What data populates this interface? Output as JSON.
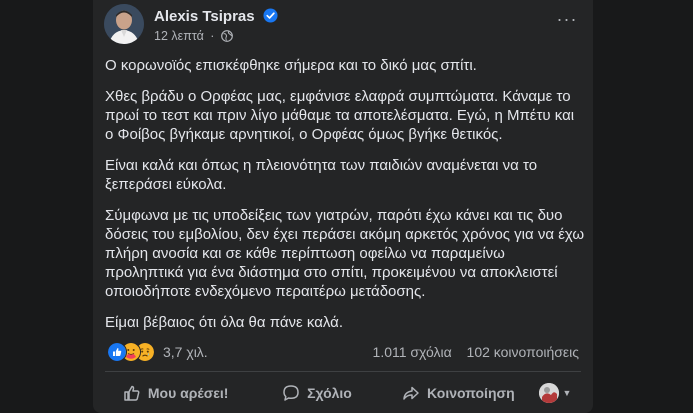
{
  "post": {
    "author": "Alexis Tsipras",
    "time": "12 λεπτά",
    "separator": "·",
    "more_label": "···",
    "paragraphs": [
      "Ο κορωνοϊός επισκέφθηκε σήμερα και το δικό μας σπίτι.",
      "Χθες βράδυ ο Ορφέας μας, εμφάνισε ελαφρά συμπτώματα. Κάναμε το πρωί το τεστ και πριν λίγο μάθαμε τα αποτελέσματα. Εγώ, η Μπέτυ και ο Φοίβος βγήκαμε αρνητικοί, ο Ορφέας όμως βγήκε θετικός.",
      "Είναι καλά και όπως η πλειονότητα των παιδιών αναμένεται να το ξεπεράσει εύκολα.",
      "Σύμφωνα με τις υποδείξεις των γιατρών, παρότι έχω κάνει και τις δυο δόσεις του εμβολίου, δεν έχει περάσει ακόμη αρκετός χρόνος για να έχω πλήρη ανοσία και σε κάθε περίπτωση οφείλω να παραμείνω προληπτικά για ένα διάστημα στο σπίτι, προκειμένου να αποκλειστεί οποιοδήποτε ενδεχόμενο περαιτέρω μετάδοσης.",
      "Είμαι βέβαιος ότι όλα θα πάνε καλά."
    ]
  },
  "stats": {
    "reactions": "3,7 χιλ.",
    "comments": "1.011 σχόλια",
    "shares": "102 κοινοποιήσεις",
    "reaction_icons": [
      "like-icon",
      "care-icon",
      "sad-icon"
    ]
  },
  "actions": {
    "like": "Μου αρέσει!",
    "comment": "Σχόλιο",
    "share": "Κοινοποίηση"
  },
  "colors": {
    "background": "#18191a",
    "card": "#242526",
    "text": "#e4e6eb",
    "secondary": "#b0b3b8",
    "like_blue": "#1877f2",
    "care_red": "#f33e58",
    "sad_yellow": "#f7b125",
    "divider": "#3e4042"
  }
}
